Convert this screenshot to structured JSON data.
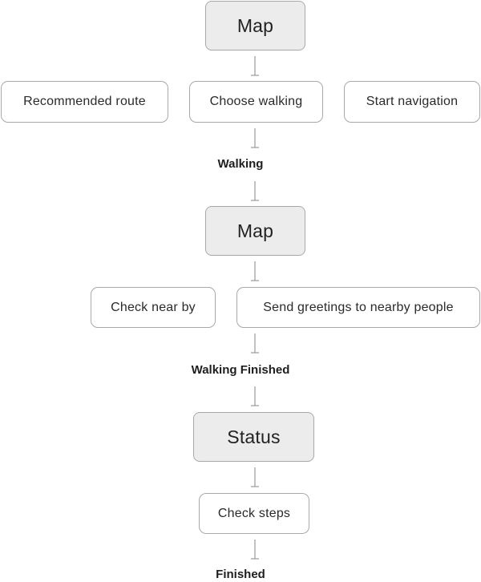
{
  "diagram": {
    "screen_map_1": "Map",
    "action_recommended_route": "Recommended route",
    "action_choose_walking": "Choose walking",
    "action_start_navigation": "Start navigation",
    "stage_walking": "Walking",
    "screen_map_2": "Map",
    "action_check_near_by": "Check near by",
    "action_send_greetings": "Send greetings to nearby people",
    "stage_walking_finished": "Walking Finished",
    "screen_status": "Status",
    "action_check_steps": "Check steps",
    "stage_finished": "Finished"
  },
  "colors": {
    "screen_fill": "#ececec",
    "box_border": "#a8a8a8",
    "connector": "#9a9a9a"
  }
}
